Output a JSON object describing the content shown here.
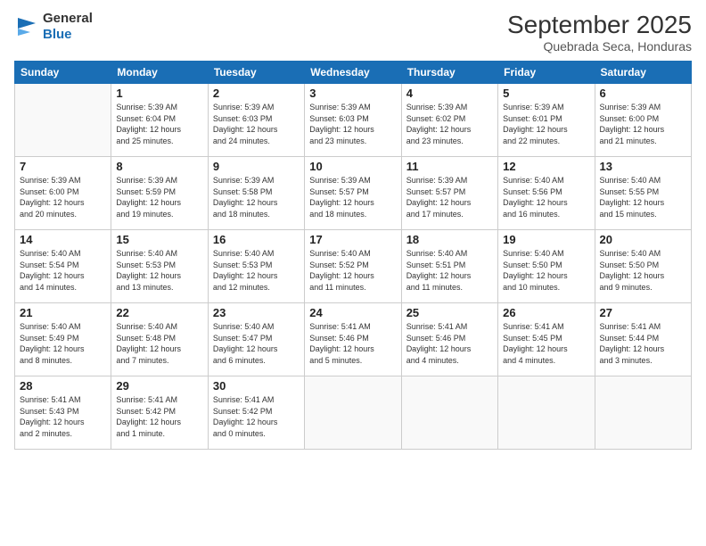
{
  "logo": {
    "line1": "General",
    "line2": "Blue"
  },
  "title": "September 2025",
  "location": "Quebrada Seca, Honduras",
  "days_header": [
    "Sunday",
    "Monday",
    "Tuesday",
    "Wednesday",
    "Thursday",
    "Friday",
    "Saturday"
  ],
  "weeks": [
    [
      {
        "day": "",
        "info": ""
      },
      {
        "day": "1",
        "info": "Sunrise: 5:39 AM\nSunset: 6:04 PM\nDaylight: 12 hours\nand 25 minutes."
      },
      {
        "day": "2",
        "info": "Sunrise: 5:39 AM\nSunset: 6:03 PM\nDaylight: 12 hours\nand 24 minutes."
      },
      {
        "day": "3",
        "info": "Sunrise: 5:39 AM\nSunset: 6:03 PM\nDaylight: 12 hours\nand 23 minutes."
      },
      {
        "day": "4",
        "info": "Sunrise: 5:39 AM\nSunset: 6:02 PM\nDaylight: 12 hours\nand 23 minutes."
      },
      {
        "day": "5",
        "info": "Sunrise: 5:39 AM\nSunset: 6:01 PM\nDaylight: 12 hours\nand 22 minutes."
      },
      {
        "day": "6",
        "info": "Sunrise: 5:39 AM\nSunset: 6:00 PM\nDaylight: 12 hours\nand 21 minutes."
      }
    ],
    [
      {
        "day": "7",
        "info": "Sunrise: 5:39 AM\nSunset: 6:00 PM\nDaylight: 12 hours\nand 20 minutes."
      },
      {
        "day": "8",
        "info": "Sunrise: 5:39 AM\nSunset: 5:59 PM\nDaylight: 12 hours\nand 19 minutes."
      },
      {
        "day": "9",
        "info": "Sunrise: 5:39 AM\nSunset: 5:58 PM\nDaylight: 12 hours\nand 18 minutes."
      },
      {
        "day": "10",
        "info": "Sunrise: 5:39 AM\nSunset: 5:57 PM\nDaylight: 12 hours\nand 18 minutes."
      },
      {
        "day": "11",
        "info": "Sunrise: 5:39 AM\nSunset: 5:57 PM\nDaylight: 12 hours\nand 17 minutes."
      },
      {
        "day": "12",
        "info": "Sunrise: 5:40 AM\nSunset: 5:56 PM\nDaylight: 12 hours\nand 16 minutes."
      },
      {
        "day": "13",
        "info": "Sunrise: 5:40 AM\nSunset: 5:55 PM\nDaylight: 12 hours\nand 15 minutes."
      }
    ],
    [
      {
        "day": "14",
        "info": "Sunrise: 5:40 AM\nSunset: 5:54 PM\nDaylight: 12 hours\nand 14 minutes."
      },
      {
        "day": "15",
        "info": "Sunrise: 5:40 AM\nSunset: 5:53 PM\nDaylight: 12 hours\nand 13 minutes."
      },
      {
        "day": "16",
        "info": "Sunrise: 5:40 AM\nSunset: 5:53 PM\nDaylight: 12 hours\nand 12 minutes."
      },
      {
        "day": "17",
        "info": "Sunrise: 5:40 AM\nSunset: 5:52 PM\nDaylight: 12 hours\nand 11 minutes."
      },
      {
        "day": "18",
        "info": "Sunrise: 5:40 AM\nSunset: 5:51 PM\nDaylight: 12 hours\nand 11 minutes."
      },
      {
        "day": "19",
        "info": "Sunrise: 5:40 AM\nSunset: 5:50 PM\nDaylight: 12 hours\nand 10 minutes."
      },
      {
        "day": "20",
        "info": "Sunrise: 5:40 AM\nSunset: 5:50 PM\nDaylight: 12 hours\nand 9 minutes."
      }
    ],
    [
      {
        "day": "21",
        "info": "Sunrise: 5:40 AM\nSunset: 5:49 PM\nDaylight: 12 hours\nand 8 minutes."
      },
      {
        "day": "22",
        "info": "Sunrise: 5:40 AM\nSunset: 5:48 PM\nDaylight: 12 hours\nand 7 minutes."
      },
      {
        "day": "23",
        "info": "Sunrise: 5:40 AM\nSunset: 5:47 PM\nDaylight: 12 hours\nand 6 minutes."
      },
      {
        "day": "24",
        "info": "Sunrise: 5:41 AM\nSunset: 5:46 PM\nDaylight: 12 hours\nand 5 minutes."
      },
      {
        "day": "25",
        "info": "Sunrise: 5:41 AM\nSunset: 5:46 PM\nDaylight: 12 hours\nand 4 minutes."
      },
      {
        "day": "26",
        "info": "Sunrise: 5:41 AM\nSunset: 5:45 PM\nDaylight: 12 hours\nand 4 minutes."
      },
      {
        "day": "27",
        "info": "Sunrise: 5:41 AM\nSunset: 5:44 PM\nDaylight: 12 hours\nand 3 minutes."
      }
    ],
    [
      {
        "day": "28",
        "info": "Sunrise: 5:41 AM\nSunset: 5:43 PM\nDaylight: 12 hours\nand 2 minutes."
      },
      {
        "day": "29",
        "info": "Sunrise: 5:41 AM\nSunset: 5:42 PM\nDaylight: 12 hours\nand 1 minute."
      },
      {
        "day": "30",
        "info": "Sunrise: 5:41 AM\nSunset: 5:42 PM\nDaylight: 12 hours\nand 0 minutes."
      },
      {
        "day": "",
        "info": ""
      },
      {
        "day": "",
        "info": ""
      },
      {
        "day": "",
        "info": ""
      },
      {
        "day": "",
        "info": ""
      }
    ]
  ]
}
